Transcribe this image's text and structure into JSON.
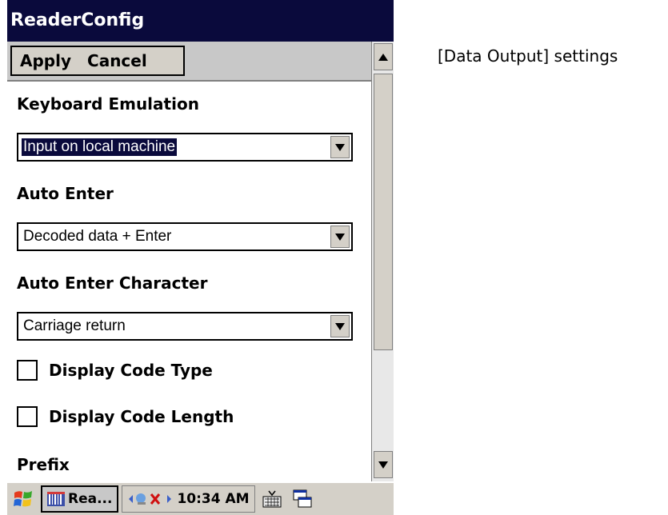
{
  "window": {
    "title": "ReaderConfig"
  },
  "command_bar": {
    "apply_label": "Apply",
    "cancel_label": "Cancel"
  },
  "settings": {
    "keyboard_emulation": {
      "label": "Keyboard Emulation",
      "value": "Input on local machine"
    },
    "auto_enter": {
      "label": "Auto Enter",
      "value": "Decoded data + Enter"
    },
    "auto_enter_character": {
      "label": "Auto Enter Character",
      "value": "Carriage return"
    },
    "display_code_type": {
      "label": "Display Code Type",
      "checked": false
    },
    "display_code_length": {
      "label": "Display Code Length",
      "checked": false
    },
    "prefix": {
      "label": "Prefix"
    }
  },
  "taskbar": {
    "task_label": "Rea...",
    "clock": "10:34 AM"
  },
  "annotation": {
    "text": "[Data Output] settings",
    "color": "#e00000"
  },
  "colors": {
    "titlebar": "#0a0a3c",
    "selection": "#0a0a3c"
  }
}
